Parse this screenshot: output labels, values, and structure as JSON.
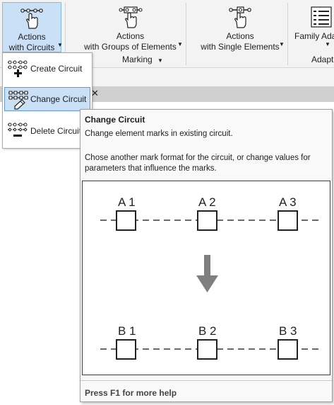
{
  "ribbon": {
    "buttons": [
      {
        "line1": "Actions",
        "line2": "with Circuits"
      },
      {
        "line1": "Actions",
        "line2": "with Groups of Elements"
      },
      {
        "line1": "Actions",
        "line2": "with Single Elements"
      },
      {
        "line1": "Family Ada"
      }
    ],
    "groups": {
      "marking": "Marking",
      "adapt": "Adapt"
    }
  },
  "menu": {
    "items": [
      {
        "label": "Create Circuit"
      },
      {
        "label": "Change Circuit"
      },
      {
        "label": "Delete Circuit"
      }
    ]
  },
  "tooltip": {
    "title": "Change Circuit",
    "description": "Change element marks in existing circuit.",
    "details": "Chose another mark format for the circuit, or change values for parameters that influence the marks.",
    "help": "Press F1 for more help",
    "figure": {
      "top_labels": [
        "A 1",
        "A 2",
        "A 3"
      ],
      "bottom_labels": [
        "B 1",
        "B 2",
        "B 3"
      ]
    }
  },
  "close_label": "✕",
  "colors": {
    "selected_bg": "#c9e0f7",
    "selected_border": "#5d9ad8",
    "arrow": "#7f7f7f"
  }
}
